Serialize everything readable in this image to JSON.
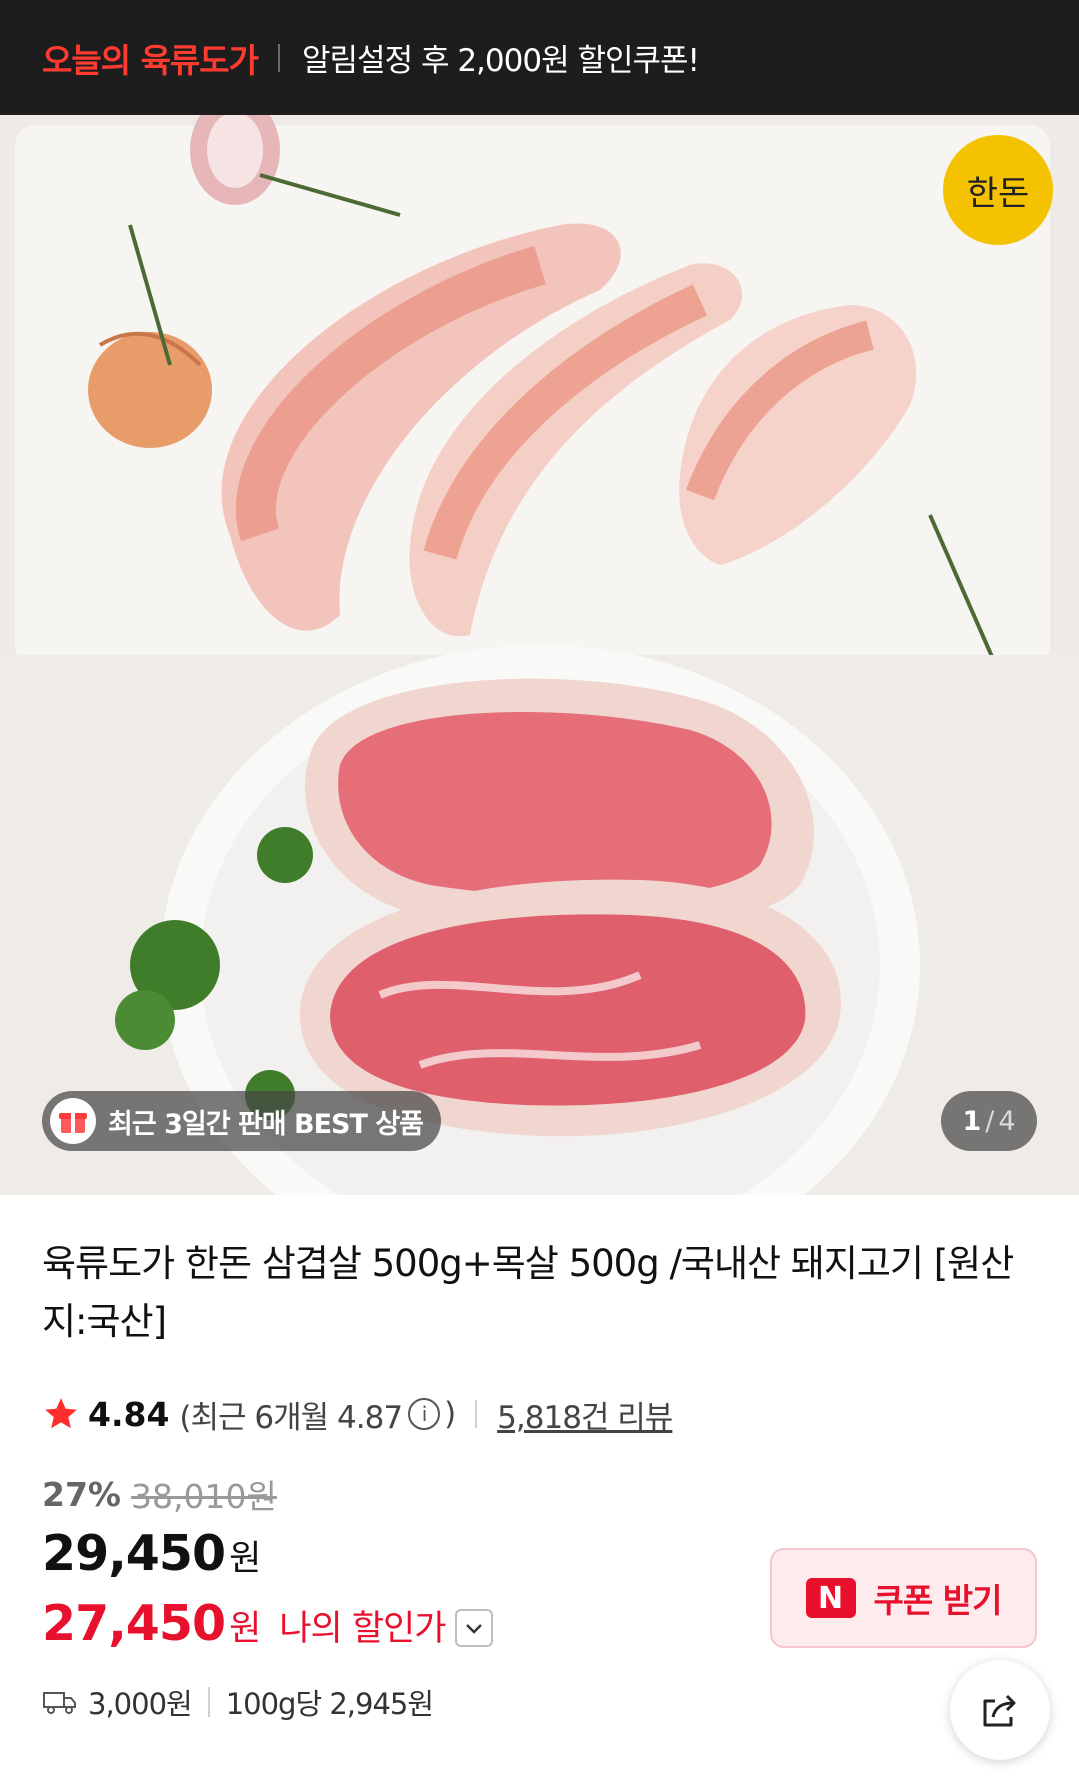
{
  "promo_banner": {
    "store_name": "오늘의 육류도가",
    "message": "알림설정 후 2,000원 할인쿠폰!"
  },
  "gallery": {
    "best_badge": "최근 3일간 판매 BEST 상품",
    "current_page": "1",
    "separator": "/",
    "total_pages": "4",
    "logo_alt": "한돈"
  },
  "product": {
    "title": "육류도가 한돈 삼겹살 500g+목살 500g /국내산 돼지고기 [원산지:국산]",
    "rating": "4.84",
    "recent_rating_prefix": "(최근 6개월 4.87",
    "recent_rating_suffix": ")",
    "review_count": "5,818건 리뷰",
    "discount_percent": "27%",
    "original_price": "38,010원",
    "price_number": "29,450",
    "price_unit": "원",
    "my_price_number": "27,450",
    "my_price_unit": "원",
    "my_price_label": "나의 할인가",
    "coupon_button": "쿠폰 받기",
    "coupon_logo": "N",
    "shipping_fee": "3,000원",
    "unit_price": "100g당 2,945원"
  },
  "colors": {
    "accent_red": "#e8112d",
    "banner_bg": "#1d1d1d",
    "star": "#ff2d2d"
  },
  "icons": [
    "gift-icon",
    "star-icon",
    "info-icon",
    "chevron-down-icon",
    "truck-icon",
    "share-icon"
  ]
}
